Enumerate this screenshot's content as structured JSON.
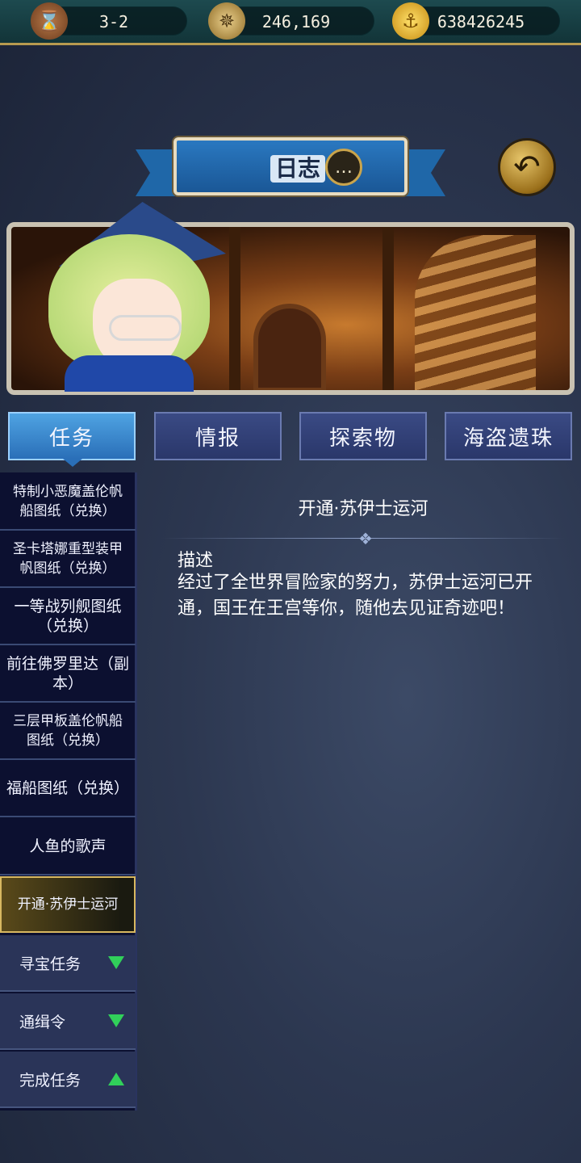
{
  "resources": {
    "stage": "3-2",
    "compass_value": "246,169",
    "gold_value": "638426245"
  },
  "header": {
    "title": "日志"
  },
  "tabs": [
    {
      "label": "任务",
      "active": true
    },
    {
      "label": "情报",
      "active": false
    },
    {
      "label": "探索物",
      "active": false
    },
    {
      "label": "海盗遗珠",
      "active": false
    }
  ],
  "quest_list": [
    {
      "label": "特制小恶魔盖伦帆船图纸（兑换）"
    },
    {
      "label": "圣卡塔娜重型装甲帆图纸（兑换）"
    },
    {
      "label": "一等战列舰图纸（兑换）"
    },
    {
      "label": "前往佛罗里达（副本）"
    },
    {
      "label": "三层甲板盖伦帆船图纸（兑换）"
    },
    {
      "label": "福船图纸（兑换）"
    },
    {
      "label": "人鱼的歌声"
    },
    {
      "label": "开通·苏伊士运河",
      "active": true
    }
  ],
  "categories": [
    {
      "label": "寻宝任务",
      "arrow": "down"
    },
    {
      "label": "通缉令",
      "arrow": "down"
    },
    {
      "label": "完成任务",
      "arrow": "up"
    }
  ],
  "detail": {
    "title": "开通·苏伊士运河",
    "desc_label": "描述",
    "description": "经过了全世界冒险家的努力，苏伊士运河已开通，国王在王宫等你，随他去见证奇迹吧！"
  },
  "colors": {
    "accent_tab": "#2a6fb8",
    "arrow": "#31d05a",
    "active_item_border": "#d8b860"
  }
}
